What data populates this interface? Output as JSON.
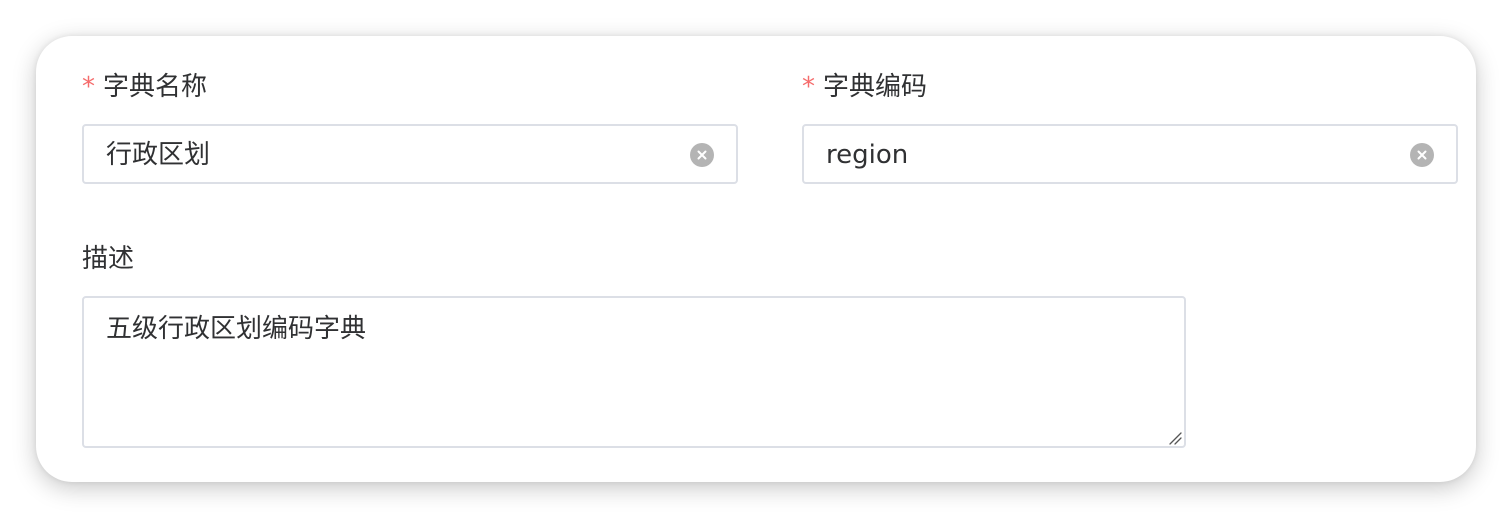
{
  "form": {
    "dict_name": {
      "required_mark": "*",
      "label": "字典名称",
      "value": "行政区划"
    },
    "dict_code": {
      "required_mark": "*",
      "label": "字典编码",
      "value": "region"
    },
    "description": {
      "label": "描述",
      "value": "五级行政区划编码字典"
    }
  },
  "icons": {
    "clear": "circle-close-icon",
    "resize": "resize-grip-icon"
  },
  "colors": {
    "required": "#f56c6c",
    "text": "#303133",
    "border": "#dcdfe6",
    "clear_icon": "#b4b4b4"
  }
}
